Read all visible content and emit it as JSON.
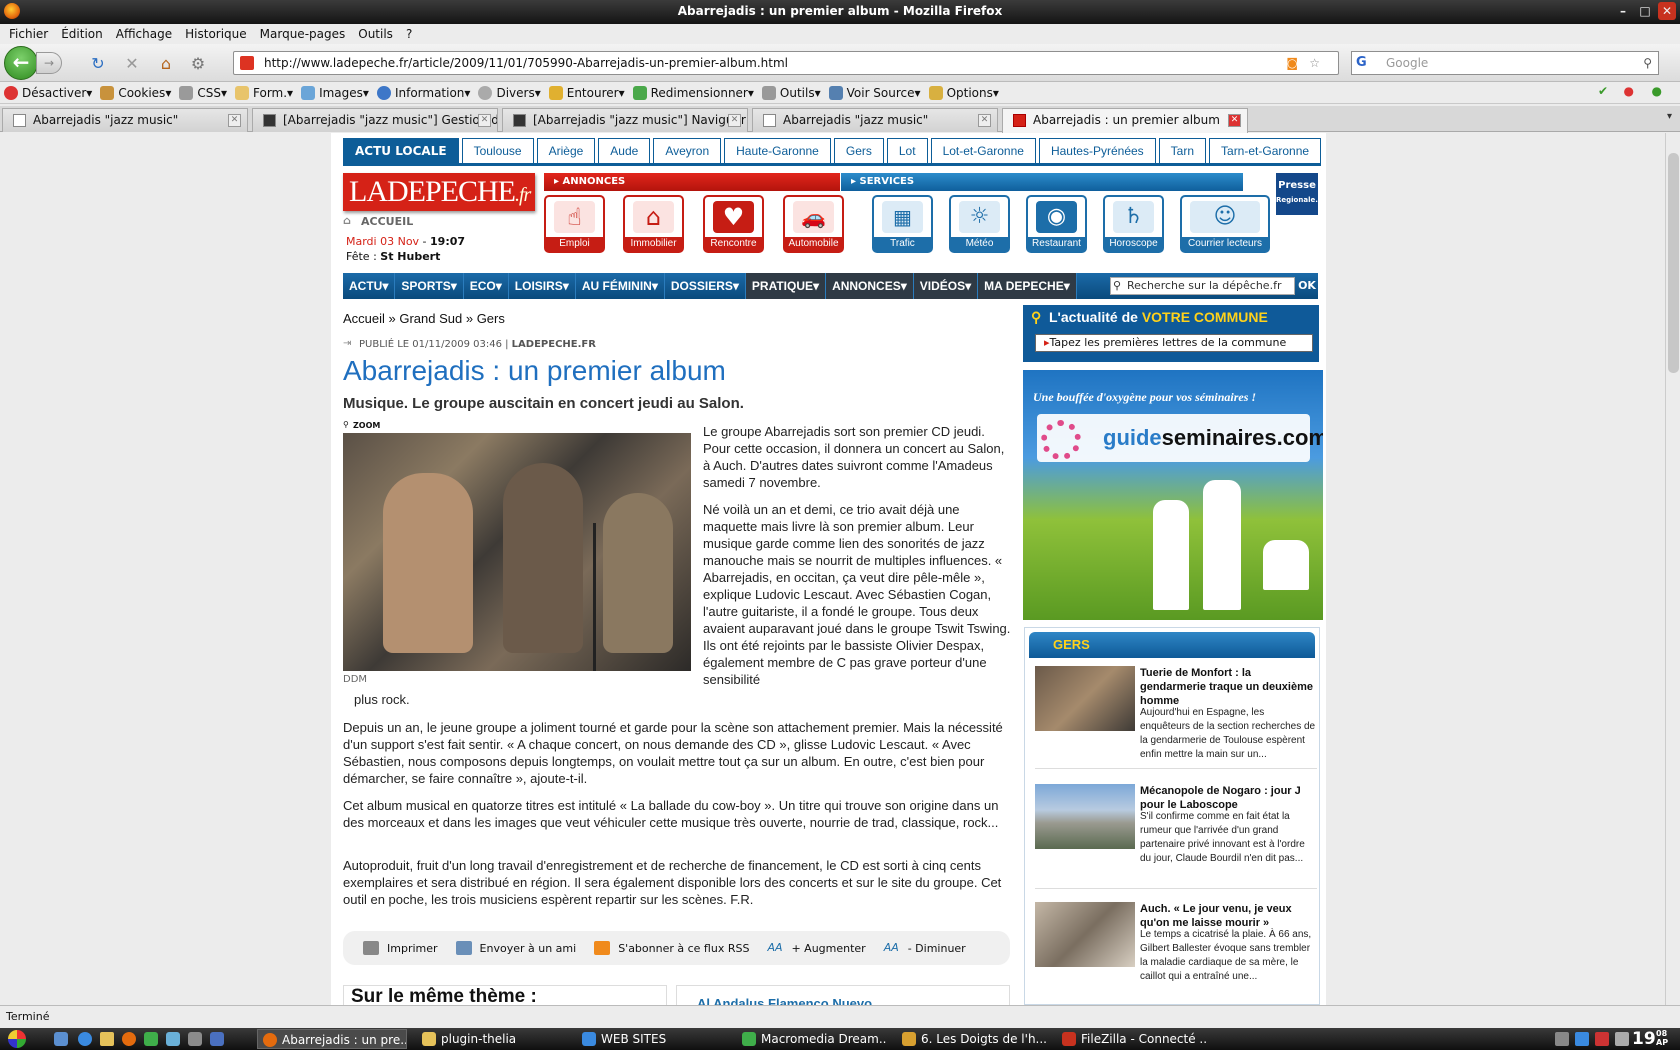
{
  "window": {
    "title": "Abarrejadis : un premier album - Mozilla Firefox"
  },
  "menu": [
    "Fichier",
    "Édition",
    "Affichage",
    "Historique",
    "Marque-pages",
    "Outils",
    "?"
  ],
  "nav": {
    "url": "http://www.ladepeche.fr/article/2009/11/01/705990-Abarrejadis-un-premier-album.html",
    "search_placeholder": "Google"
  },
  "devtoolbar": [
    "Désactiver",
    "Cookies",
    "CSS",
    "Form.",
    "Images",
    "Information",
    "Divers",
    "Entourer",
    "Redimensionner",
    "Outils",
    "Voir Source",
    "Options"
  ],
  "tabs": [
    "Abarrejadis \"jazz music\"",
    "[Abarrejadis \"jazz music\"] Gestion de...",
    "[Abarrejadis \"jazz music\"] Naviguer d...",
    "Abarrejadis \"jazz music\"",
    "Abarrejadis : un premier album"
  ],
  "site": {
    "top_nav_lead": "ACTU LOCALE",
    "top_nav": [
      "Toulouse",
      "Ariège",
      "Aude",
      "Aveyron",
      "Haute-Garonne",
      "Gers",
      "Lot",
      "Lot-et-Garonne",
      "Hautes-Pyrénées",
      "Tarn",
      "Tarn-et-Garonne"
    ],
    "logo_main": "LADEPECHE",
    "logo_ext": ".fr",
    "accueil": "ACCUEIL",
    "date": "Mardi 03 Nov",
    "time": "19:07",
    "fete_label": "Fête :",
    "fete_name": "St Hubert",
    "annonces_label": "ANNONCES",
    "services_label": "SERVICES",
    "presse_label": "Presse",
    "presse_sub": "Regionale.fr",
    "services": [
      "Emploi",
      "Immobilier",
      "Rencontre",
      "Automobile",
      "Trafic",
      "Météo",
      "Restaurant",
      "Horoscope",
      "Courrier lecteurs"
    ],
    "main_nav": [
      "ACTU",
      "SPORTS",
      "ECO",
      "LOISIRS",
      "AU FÉMININ",
      "DOSSIERS",
      "PRATIQUE",
      "ANNONCES",
      "VIDÉOS",
      "MA DEPECHE"
    ],
    "search_placeholder": "Recherche sur la dépêche.fr",
    "search_ok": "OK"
  },
  "article": {
    "breadcrumb": "Accueil » Grand Sud » Gers",
    "published": "PUBLIÉ LE 01/11/2009 03:46 |",
    "source": "LADEPECHE.FR",
    "title": "Abarrejadis : un premier album",
    "subtitle": "Musique. Le groupe auscitain en concert jeudi au Salon.",
    "zoom": "ZOOM",
    "photo_credit": "DDM",
    "p1": "Le groupe Abarrejadis sort son premier CD jeudi. Pour cette occasion, il donnera un concert au Salon, à Auch. D'autres dates suivront comme l'Amadeus samedi 7 novembre.",
    "p2": "Né voilà un an et demi, ce trio avait déjà une maquette mais livre là son premier album. Leur musique garde comme lien des sonorités de jazz manouche mais se nourrit de multiples influences. « Abarrejadis, en occitan, ça veut dire pêle-mêle », explique Ludovic Lescaut. Avec Sébastien Cogan, l'autre guitariste, il a fondé le groupe. Tous deux avaient auparavant joué dans le groupe Tswit Tswing. Ils ont été rejoints par le bassiste Olivier Despax, également membre de C pas grave porteur d'une sensibilité",
    "p2_tail": "plus rock.",
    "p3": "Depuis un an, le jeune groupe a joliment tourné et garde pour la scène son attachement premier. Mais la nécessité d'un support s'est fait sentir. « A chaque concert, on nous demande des CD », glisse Ludovic Lescaut. « Avec Sébastien, nous composons depuis longtemps, on voulait mettre tout ça sur un album. En outre, c'est bien pour démarcher, se faire connaître », ajoute-t-il.",
    "p4": "Cet album musical en quatorze titres est intitulé « La ballade du cow-boy ». Un titre qui trouve son origine dans un des morceaux et dans les images que veut véhiculer cette musique très ouverte, nourrie de trad, classique, rock...",
    "p5": "Autoproduit, fruit d'un long travail d'enregistrement et de recherche de financement, le CD est sorti à cinq cents exemplaires et sera distribué en région. Il sera également disponible lors des concerts et sur le site du groupe. Cet outil en poche, les trois musiciens espèrent repartir sur les scènes. F.R.",
    "tools": [
      "Imprimer",
      "Envoyer à un ami",
      "S'abonner à ce flux RSS",
      "+ Augmenter",
      "- Diminuer"
    ],
    "same_theme": "Sur le même thème :",
    "related_link": "Al Andalus Flamenco Nuevo"
  },
  "sidebar": {
    "commune_title_a": "L'actualité de",
    "commune_title_b": "VOTRE COMMUNE",
    "commune_input": "Tapez les premières lettres de la commune",
    "ad_tagline": "Une bouffée d'oxygène pour vos séminaires !",
    "ad_brand_a": "guide",
    "ad_brand_b": "seminaires.com",
    "gers_title": "GERS",
    "news": [
      {
        "title": "Tuerie de Monfort : la gendarmerie traque un deuxième homme",
        "body": "Aujourd'hui en Espagne, les enquêteurs de la section recherches de la gendarmerie de Toulouse espèrent enfin mettre la main sur un..."
      },
      {
        "title": "Mécanopole de Nogaro : jour J pour le Laboscope",
        "body": "S'il confirme comme en fait état la rumeur que l'arrivée d'un grand partenaire privé innovant est à l'ordre du jour, Claude Bourdil n'en dit pas..."
      },
      {
        "title": "Auch. « Le jour venu, je veux qu'on me laisse mourir »",
        "body": "Le temps a cicatrisé la plaie. À 66 ans, Gilbert Ballester évoque sans trembler la maladie cardiaque de sa mère, le caillot qui a entraîné une..."
      }
    ]
  },
  "status": "Terminé",
  "taskbar": {
    "items": [
      "Abarrejadis : un pre...",
      "plugin-thelia",
      "WEB SITES",
      "Macromedia Dream...",
      "6. Les Doigts de l'h...",
      "FileZilla - Connecté ..."
    ],
    "clock": "19",
    "clock_min": "08",
    "clock_ap": "AP"
  },
  "colors": {
    "brand_red": "#d52217",
    "brand_blue": "#0d5d98",
    "title_blue": "#1f6fbf",
    "accent_yellow": "#ffd21a"
  }
}
